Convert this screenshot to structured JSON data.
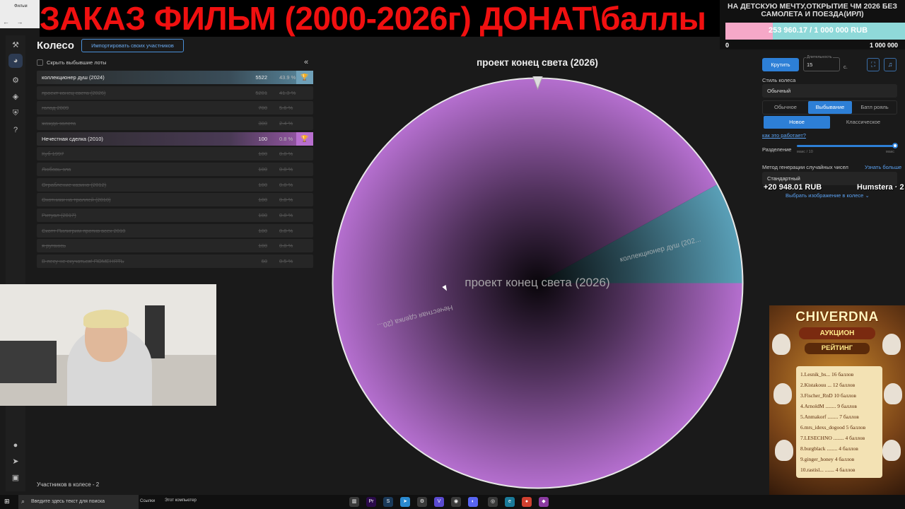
{
  "browser": {
    "tab_label": "Фильм"
  },
  "overlay_title": "ЗАКАЗ ФИЛЬМ (2000-2026г) ДОНАТ\\баллы",
  "goal": {
    "title": "НА ДЕТСКУЮ МЕЧТУ,ОТКРЫТИЕ ЧМ 2026 БЕЗ САМОЛЕТА И ПОЕЗДА(ИРЛ)",
    "amount": "253 960.17 / 1 000 000 RUB",
    "progress": 0.254,
    "min": "0",
    "max": "1 000 000",
    "colors": {
      "fill": "#f6a8c8",
      "rest": "#8fd9d9"
    }
  },
  "sidebar": {
    "icons": [
      "hammer-icon",
      "wheel-icon",
      "gear-icon",
      "layers-icon",
      "shield-icon",
      "help-icon",
      "github-icon",
      "telegram-icon",
      "twitch-icon"
    ]
  },
  "header": {
    "title": "Колесо",
    "import_label": "Импортировать своих участников",
    "hide_label": "Скрыть выбывшие лоты"
  },
  "lots": [
    {
      "name": "коллекционер душ (2024)",
      "amount": "5522",
      "pct": "43.9 %",
      "state": "active1"
    },
    {
      "name": "проект конец света (2026)",
      "amount": "5201",
      "pct": "41.3 %",
      "state": "strike"
    },
    {
      "name": "голод 2009",
      "amount": "700",
      "pct": "5.6 %",
      "state": "strike"
    },
    {
      "name": "жажда золота",
      "amount": "300",
      "pct": "2.4 %",
      "state": "strike"
    },
    {
      "name": "Нечестная сделка (2010)",
      "amount": "100",
      "pct": "0.8 %",
      "state": "active2"
    },
    {
      "name": "Куб 1997",
      "amount": "100",
      "pct": "0.8 %",
      "state": "strike"
    },
    {
      "name": "Любовь-зла",
      "amount": "100",
      "pct": "0.8 %",
      "state": "strike"
    },
    {
      "name": "Ограбление казино (2012)",
      "amount": "100",
      "pct": "0.8 %",
      "state": "strike"
    },
    {
      "name": "Охотники на троллей (2010)",
      "amount": "100",
      "pct": "0.8 %",
      "state": "strike"
    },
    {
      "name": "Ритуал (2017)",
      "amount": "100",
      "pct": "0.8 %",
      "state": "strike"
    },
    {
      "name": "Скотт Пилигрим против всех 2010",
      "amount": "100",
      "pct": "0.8 %",
      "state": "strike"
    },
    {
      "name": "я ругаюсь",
      "amount": "100",
      "pct": "0.8 %",
      "state": "strike"
    },
    {
      "name": "В лесу не скучаться! ПОМЕНЯТЬ",
      "amount": "60",
      "pct": "0.5 %",
      "state": "strike"
    }
  ],
  "participants_label": "Участников в колесе - 2",
  "wheel": {
    "winner_title": "проект конец света (2026)",
    "center_label": "проект конец света (2026)",
    "slices": [
      {
        "label": "коллекционер душ (202...",
        "share": 0.08,
        "color": "#5aa0b8"
      },
      {
        "label": "Нечестная сделка (20...",
        "share": 0.92,
        "color": "#b56fcf"
      }
    ]
  },
  "controls": {
    "spin_label": "Крутить",
    "duration_caption": "Длительность",
    "duration_value": "15",
    "duration_unit": "с.",
    "style_label": "Стиль колеса",
    "style_value": "Обычный",
    "modes": [
      "Обычное",
      "Выбывание",
      "Батл рояль"
    ],
    "active_mode": "Выбывание",
    "sub_modes": [
      "Новое",
      "Классическое"
    ],
    "active_sub_mode": "Новое",
    "how_it_works": "как это работает?",
    "split_label": "Разделение",
    "split_min": "макс / 10",
    "split_max": "макс",
    "split_value": 1.0,
    "rng_label": "Метод генерации случайных чисел",
    "rng_more": "Узнать больше",
    "rng_value": "Стандартный",
    "image_link": "Выбрать изображение в колесе"
  },
  "auction": {
    "brand": "CHIVERDNA",
    "subtitle": "АУКЦИОН",
    "rating_title": "РЕЙТИНГ",
    "rows": [
      "1.Lesnik_bs... 16 баллов",
      "2.Kistakouu ... 12 баллов",
      "3.Fischer_RnD  10 баллов",
      "4.ArnoldM ........ 9 баллов",
      "5.Anmakorf ........ 7 баллов",
      "6.mrs_idexs_dogood 5 баллов",
      "7.LESECHNO ........ 4 баллов",
      "8.burgblack ........ 4 баллов",
      "9.ginger_honey  4 баллов",
      "10.rastisl... ....... 4 баллов"
    ],
    "total": "+20 948.01 RUB",
    "user": "Humstera · 2"
  },
  "taskbar": {
    "search_placeholder": "Введите здесь текст для поиска",
    "links": "Ссылки",
    "this_pc": "Этот компьютер"
  }
}
